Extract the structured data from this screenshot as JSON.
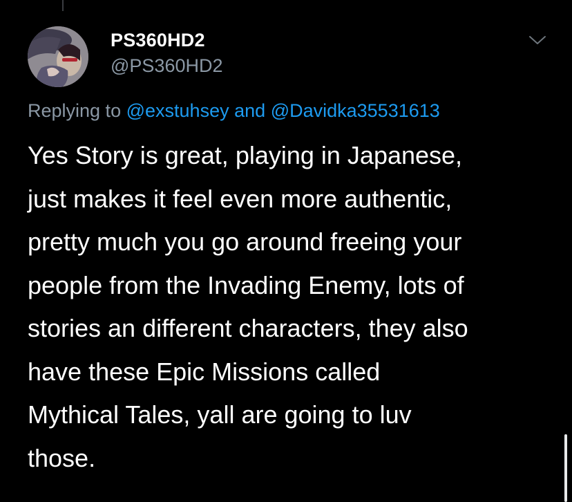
{
  "author": {
    "display_name": "PS360HD2",
    "handle": "@PS360HD2",
    "avatar_icon": "avatar-icon"
  },
  "header": {
    "more_icon": "chevron-down-icon"
  },
  "reply": {
    "prefix": "Replying to",
    "mentions": [
      "@exstuhsey",
      "@Davidka35531613"
    ],
    "connector": "and"
  },
  "tweet": {
    "lines": [
      "Yes Story is great, playing in Japanese,",
      "just makes it feel even more authentic,",
      "pretty much you go around freeing your",
      "people from the Invading Enemy, lots of",
      "stories an different characters, they also",
      "have these Epic Missions called",
      "Mythical Tales, yall are going to luv",
      "those."
    ]
  },
  "colors": {
    "background": "#000000",
    "primary_text": "#ffffff",
    "secondary_text": "#8b98a5",
    "link": "#1d9bf0"
  }
}
